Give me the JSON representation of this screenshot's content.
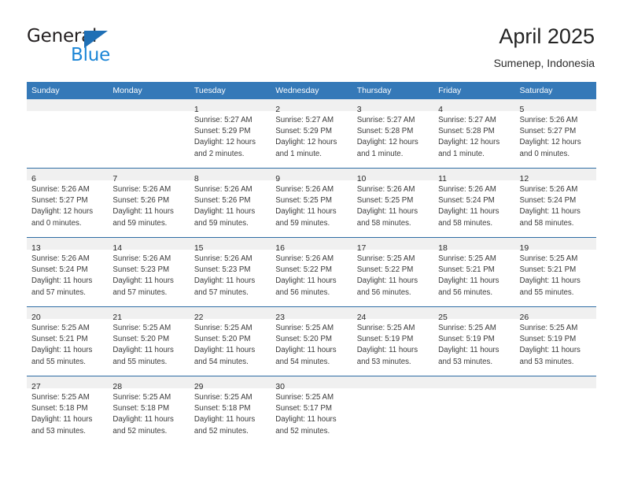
{
  "brand": {
    "name_top": "General",
    "name_bottom": "Blue",
    "accent_blue": "#1b85d6",
    "triangle_blue": "#1f6fb5"
  },
  "header": {
    "title": "April 2025",
    "subtitle": "Sumenep, Indonesia"
  },
  "theme": {
    "header_bg": "#3579b8",
    "row_divider": "#2e6da4",
    "daynum_band": "#f0f0f0",
    "text": "#3a3a3a"
  },
  "calendar": {
    "weekday_headers": [
      "Sunday",
      "Monday",
      "Tuesday",
      "Wednesday",
      "Thursday",
      "Friday",
      "Saturday"
    ],
    "weeks": [
      [
        {
          "day": "",
          "lines": []
        },
        {
          "day": "",
          "lines": []
        },
        {
          "day": "1",
          "lines": [
            "Sunrise: 5:27 AM",
            "Sunset: 5:29 PM",
            "Daylight: 12 hours",
            "and 2 minutes."
          ]
        },
        {
          "day": "2",
          "lines": [
            "Sunrise: 5:27 AM",
            "Sunset: 5:29 PM",
            "Daylight: 12 hours",
            "and 1 minute."
          ]
        },
        {
          "day": "3",
          "lines": [
            "Sunrise: 5:27 AM",
            "Sunset: 5:28 PM",
            "Daylight: 12 hours",
            "and 1 minute."
          ]
        },
        {
          "day": "4",
          "lines": [
            "Sunrise: 5:27 AM",
            "Sunset: 5:28 PM",
            "Daylight: 12 hours",
            "and 1 minute."
          ]
        },
        {
          "day": "5",
          "lines": [
            "Sunrise: 5:26 AM",
            "Sunset: 5:27 PM",
            "Daylight: 12 hours",
            "and 0 minutes."
          ]
        }
      ],
      [
        {
          "day": "6",
          "lines": [
            "Sunrise: 5:26 AM",
            "Sunset: 5:27 PM",
            "Daylight: 12 hours",
            "and 0 minutes."
          ]
        },
        {
          "day": "7",
          "lines": [
            "Sunrise: 5:26 AM",
            "Sunset: 5:26 PM",
            "Daylight: 11 hours",
            "and 59 minutes."
          ]
        },
        {
          "day": "8",
          "lines": [
            "Sunrise: 5:26 AM",
            "Sunset: 5:26 PM",
            "Daylight: 11 hours",
            "and 59 minutes."
          ]
        },
        {
          "day": "9",
          "lines": [
            "Sunrise: 5:26 AM",
            "Sunset: 5:25 PM",
            "Daylight: 11 hours",
            "and 59 minutes."
          ]
        },
        {
          "day": "10",
          "lines": [
            "Sunrise: 5:26 AM",
            "Sunset: 5:25 PM",
            "Daylight: 11 hours",
            "and 58 minutes."
          ]
        },
        {
          "day": "11",
          "lines": [
            "Sunrise: 5:26 AM",
            "Sunset: 5:24 PM",
            "Daylight: 11 hours",
            "and 58 minutes."
          ]
        },
        {
          "day": "12",
          "lines": [
            "Sunrise: 5:26 AM",
            "Sunset: 5:24 PM",
            "Daylight: 11 hours",
            "and 58 minutes."
          ]
        }
      ],
      [
        {
          "day": "13",
          "lines": [
            "Sunrise: 5:26 AM",
            "Sunset: 5:24 PM",
            "Daylight: 11 hours",
            "and 57 minutes."
          ]
        },
        {
          "day": "14",
          "lines": [
            "Sunrise: 5:26 AM",
            "Sunset: 5:23 PM",
            "Daylight: 11 hours",
            "and 57 minutes."
          ]
        },
        {
          "day": "15",
          "lines": [
            "Sunrise: 5:26 AM",
            "Sunset: 5:23 PM",
            "Daylight: 11 hours",
            "and 57 minutes."
          ]
        },
        {
          "day": "16",
          "lines": [
            "Sunrise: 5:26 AM",
            "Sunset: 5:22 PM",
            "Daylight: 11 hours",
            "and 56 minutes."
          ]
        },
        {
          "day": "17",
          "lines": [
            "Sunrise: 5:25 AM",
            "Sunset: 5:22 PM",
            "Daylight: 11 hours",
            "and 56 minutes."
          ]
        },
        {
          "day": "18",
          "lines": [
            "Sunrise: 5:25 AM",
            "Sunset: 5:21 PM",
            "Daylight: 11 hours",
            "and 56 minutes."
          ]
        },
        {
          "day": "19",
          "lines": [
            "Sunrise: 5:25 AM",
            "Sunset: 5:21 PM",
            "Daylight: 11 hours",
            "and 55 minutes."
          ]
        }
      ],
      [
        {
          "day": "20",
          "lines": [
            "Sunrise: 5:25 AM",
            "Sunset: 5:21 PM",
            "Daylight: 11 hours",
            "and 55 minutes."
          ]
        },
        {
          "day": "21",
          "lines": [
            "Sunrise: 5:25 AM",
            "Sunset: 5:20 PM",
            "Daylight: 11 hours",
            "and 55 minutes."
          ]
        },
        {
          "day": "22",
          "lines": [
            "Sunrise: 5:25 AM",
            "Sunset: 5:20 PM",
            "Daylight: 11 hours",
            "and 54 minutes."
          ]
        },
        {
          "day": "23",
          "lines": [
            "Sunrise: 5:25 AM",
            "Sunset: 5:20 PM",
            "Daylight: 11 hours",
            "and 54 minutes."
          ]
        },
        {
          "day": "24",
          "lines": [
            "Sunrise: 5:25 AM",
            "Sunset: 5:19 PM",
            "Daylight: 11 hours",
            "and 53 minutes."
          ]
        },
        {
          "day": "25",
          "lines": [
            "Sunrise: 5:25 AM",
            "Sunset: 5:19 PM",
            "Daylight: 11 hours",
            "and 53 minutes."
          ]
        },
        {
          "day": "26",
          "lines": [
            "Sunrise: 5:25 AM",
            "Sunset: 5:19 PM",
            "Daylight: 11 hours",
            "and 53 minutes."
          ]
        }
      ],
      [
        {
          "day": "27",
          "lines": [
            "Sunrise: 5:25 AM",
            "Sunset: 5:18 PM",
            "Daylight: 11 hours",
            "and 53 minutes."
          ]
        },
        {
          "day": "28",
          "lines": [
            "Sunrise: 5:25 AM",
            "Sunset: 5:18 PM",
            "Daylight: 11 hours",
            "and 52 minutes."
          ]
        },
        {
          "day": "29",
          "lines": [
            "Sunrise: 5:25 AM",
            "Sunset: 5:18 PM",
            "Daylight: 11 hours",
            "and 52 minutes."
          ]
        },
        {
          "day": "30",
          "lines": [
            "Sunrise: 5:25 AM",
            "Sunset: 5:17 PM",
            "Daylight: 11 hours",
            "and 52 minutes."
          ]
        },
        {
          "day": "",
          "lines": []
        },
        {
          "day": "",
          "lines": []
        },
        {
          "day": "",
          "lines": []
        }
      ]
    ]
  }
}
